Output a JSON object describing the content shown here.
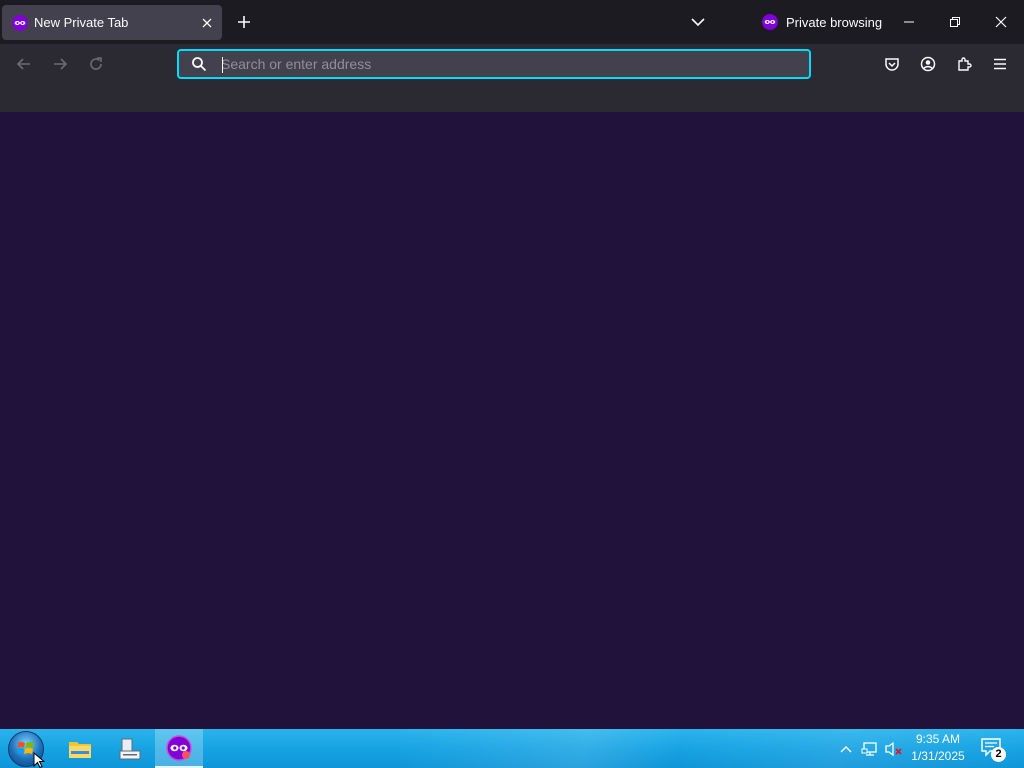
{
  "tab": {
    "title": "New Private Tab",
    "favicon": "private-mask-icon"
  },
  "titlebar": {
    "private_label": "Private browsing"
  },
  "urlbar": {
    "placeholder": "Search or enter address",
    "value": ""
  },
  "colors": {
    "accent": "#00ddff",
    "content_bg": "#20123a",
    "toolbar_bg": "#2b2a33",
    "titlebar_bg": "#1c1b22",
    "private_purple": "#8000d7"
  },
  "taskbar": {
    "clock_time": "9:35 AM",
    "clock_date": "1/31/2025",
    "notification_count": "2",
    "apps": [
      "file-explorer-icon",
      "server-manager-icon",
      "firefox-private-icon"
    ]
  }
}
